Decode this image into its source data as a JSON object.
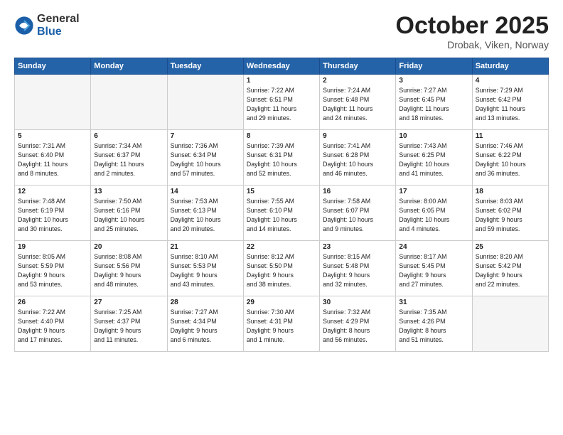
{
  "header": {
    "logo_general": "General",
    "logo_blue": "Blue",
    "month_title": "October 2025",
    "location": "Drobak, Viken, Norway"
  },
  "days_of_week": [
    "Sunday",
    "Monday",
    "Tuesday",
    "Wednesday",
    "Thursday",
    "Friday",
    "Saturday"
  ],
  "weeks": [
    [
      {
        "num": "",
        "info": "",
        "empty": true
      },
      {
        "num": "",
        "info": "",
        "empty": true
      },
      {
        "num": "",
        "info": "",
        "empty": true
      },
      {
        "num": "1",
        "info": "Sunrise: 7:22 AM\nSunset: 6:51 PM\nDaylight: 11 hours\nand 29 minutes."
      },
      {
        "num": "2",
        "info": "Sunrise: 7:24 AM\nSunset: 6:48 PM\nDaylight: 11 hours\nand 24 minutes."
      },
      {
        "num": "3",
        "info": "Sunrise: 7:27 AM\nSunset: 6:45 PM\nDaylight: 11 hours\nand 18 minutes."
      },
      {
        "num": "4",
        "info": "Sunrise: 7:29 AM\nSunset: 6:42 PM\nDaylight: 11 hours\nand 13 minutes."
      }
    ],
    [
      {
        "num": "5",
        "info": "Sunrise: 7:31 AM\nSunset: 6:40 PM\nDaylight: 11 hours\nand 8 minutes."
      },
      {
        "num": "6",
        "info": "Sunrise: 7:34 AM\nSunset: 6:37 PM\nDaylight: 11 hours\nand 2 minutes."
      },
      {
        "num": "7",
        "info": "Sunrise: 7:36 AM\nSunset: 6:34 PM\nDaylight: 10 hours\nand 57 minutes."
      },
      {
        "num": "8",
        "info": "Sunrise: 7:39 AM\nSunset: 6:31 PM\nDaylight: 10 hours\nand 52 minutes."
      },
      {
        "num": "9",
        "info": "Sunrise: 7:41 AM\nSunset: 6:28 PM\nDaylight: 10 hours\nand 46 minutes."
      },
      {
        "num": "10",
        "info": "Sunrise: 7:43 AM\nSunset: 6:25 PM\nDaylight: 10 hours\nand 41 minutes."
      },
      {
        "num": "11",
        "info": "Sunrise: 7:46 AM\nSunset: 6:22 PM\nDaylight: 10 hours\nand 36 minutes."
      }
    ],
    [
      {
        "num": "12",
        "info": "Sunrise: 7:48 AM\nSunset: 6:19 PM\nDaylight: 10 hours\nand 30 minutes."
      },
      {
        "num": "13",
        "info": "Sunrise: 7:50 AM\nSunset: 6:16 PM\nDaylight: 10 hours\nand 25 minutes."
      },
      {
        "num": "14",
        "info": "Sunrise: 7:53 AM\nSunset: 6:13 PM\nDaylight: 10 hours\nand 20 minutes."
      },
      {
        "num": "15",
        "info": "Sunrise: 7:55 AM\nSunset: 6:10 PM\nDaylight: 10 hours\nand 14 minutes."
      },
      {
        "num": "16",
        "info": "Sunrise: 7:58 AM\nSunset: 6:07 PM\nDaylight: 10 hours\nand 9 minutes."
      },
      {
        "num": "17",
        "info": "Sunrise: 8:00 AM\nSunset: 6:05 PM\nDaylight: 10 hours\nand 4 minutes."
      },
      {
        "num": "18",
        "info": "Sunrise: 8:03 AM\nSunset: 6:02 PM\nDaylight: 9 hours\nand 59 minutes."
      }
    ],
    [
      {
        "num": "19",
        "info": "Sunrise: 8:05 AM\nSunset: 5:59 PM\nDaylight: 9 hours\nand 53 minutes."
      },
      {
        "num": "20",
        "info": "Sunrise: 8:08 AM\nSunset: 5:56 PM\nDaylight: 9 hours\nand 48 minutes."
      },
      {
        "num": "21",
        "info": "Sunrise: 8:10 AM\nSunset: 5:53 PM\nDaylight: 9 hours\nand 43 minutes."
      },
      {
        "num": "22",
        "info": "Sunrise: 8:12 AM\nSunset: 5:50 PM\nDaylight: 9 hours\nand 38 minutes."
      },
      {
        "num": "23",
        "info": "Sunrise: 8:15 AM\nSunset: 5:48 PM\nDaylight: 9 hours\nand 32 minutes."
      },
      {
        "num": "24",
        "info": "Sunrise: 8:17 AM\nSunset: 5:45 PM\nDaylight: 9 hours\nand 27 minutes."
      },
      {
        "num": "25",
        "info": "Sunrise: 8:20 AM\nSunset: 5:42 PM\nDaylight: 9 hours\nand 22 minutes."
      }
    ],
    [
      {
        "num": "26",
        "info": "Sunrise: 7:22 AM\nSunset: 4:40 PM\nDaylight: 9 hours\nand 17 minutes."
      },
      {
        "num": "27",
        "info": "Sunrise: 7:25 AM\nSunset: 4:37 PM\nDaylight: 9 hours\nand 11 minutes."
      },
      {
        "num": "28",
        "info": "Sunrise: 7:27 AM\nSunset: 4:34 PM\nDaylight: 9 hours\nand 6 minutes."
      },
      {
        "num": "29",
        "info": "Sunrise: 7:30 AM\nSunset: 4:31 PM\nDaylight: 9 hours\nand 1 minute."
      },
      {
        "num": "30",
        "info": "Sunrise: 7:32 AM\nSunset: 4:29 PM\nDaylight: 8 hours\nand 56 minutes."
      },
      {
        "num": "31",
        "info": "Sunrise: 7:35 AM\nSunset: 4:26 PM\nDaylight: 8 hours\nand 51 minutes."
      },
      {
        "num": "",
        "info": "",
        "empty": true
      }
    ]
  ]
}
